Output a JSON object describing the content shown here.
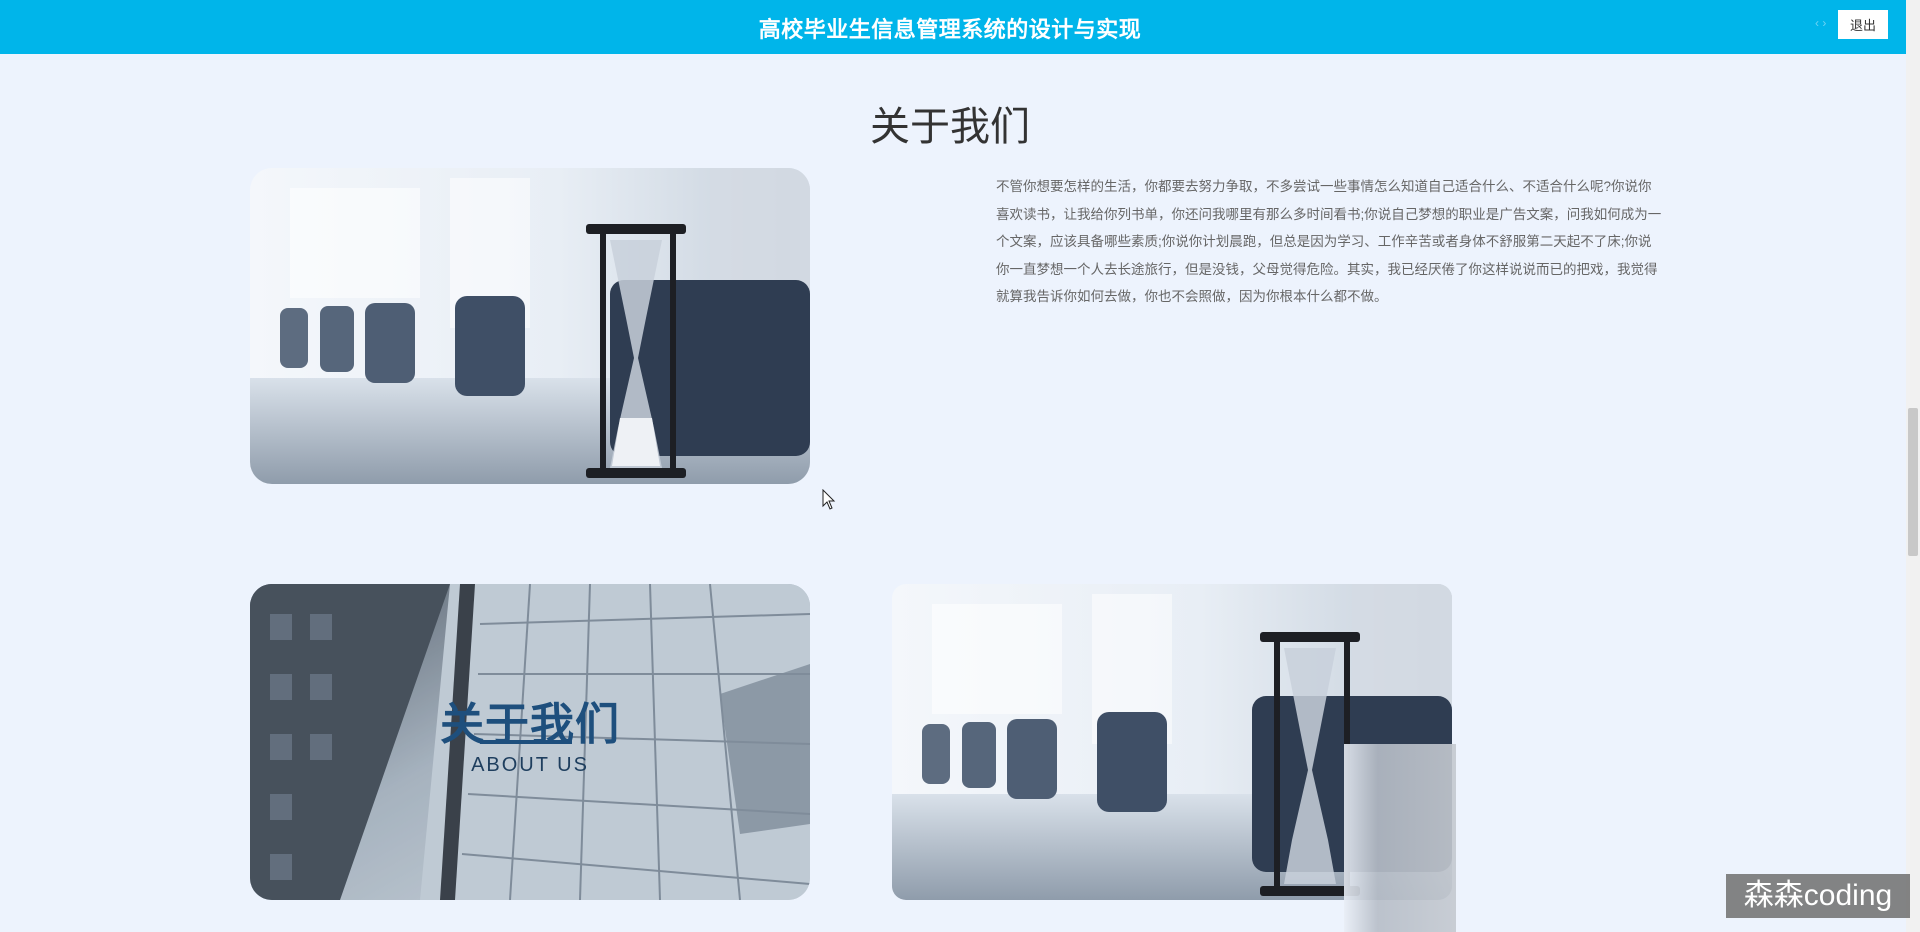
{
  "header": {
    "title": "高校毕业生信息管理系统的设计与实现",
    "dots": "‹ ›",
    "logout_label": "退出"
  },
  "about": {
    "title": "关于我们",
    "text": "不管你想要怎样的生活，你都要去努力争取，不多尝试一些事情怎么知道自己适合什么、不适合什么呢?你说你喜欢读书，让我给你列书单，你还问我哪里有那么多时间看书;你说自己梦想的职业是广告文案，问我如何成为一个文案，应该具备哪些素质;你说你计划晨跑，但总是因为学习、工作辛苦或者身体不舒服第二天起不了床;你说你一直梦想一个人去长途旅行，但是没钱，父母觉得危险。其实，我已经厌倦了你这样说说而已的把戏，我觉得就算我告诉你如何去做，你也不会照做，因为你根本什么都不做。"
  },
  "photos": {
    "overlay_title": "关于我们",
    "overlay_subtitle": "ABOUT US"
  },
  "watermark": "森森coding",
  "colors": {
    "header_bg": "#00b5ea",
    "page_bg": "#edf3fd",
    "overlay_text": "#1e4f7d"
  },
  "icons": {
    "cursor": "mouse-pointer-icon"
  }
}
